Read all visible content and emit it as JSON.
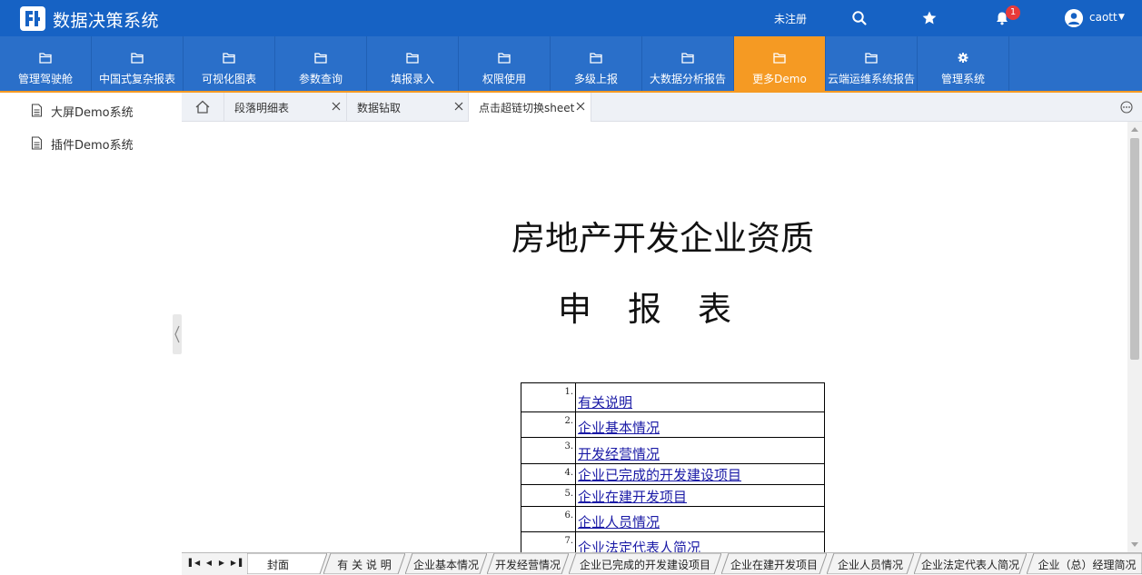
{
  "app": {
    "title": "数据决策系统",
    "brand_color": "#1662c4",
    "nav_color": "#2a6fc9",
    "accent_color": "#f59a23"
  },
  "topbar": {
    "register_label": "未注册",
    "notification_count": "1",
    "user_name": "caott",
    "icons": [
      "search-icon",
      "star-icon",
      "bell-icon",
      "user-avatar-icon",
      "caret-down-icon"
    ]
  },
  "nav": {
    "items": [
      {
        "label": "管理驾驶舱",
        "icon": "folder-icon"
      },
      {
        "label": "中国式复杂报表",
        "icon": "folder-icon"
      },
      {
        "label": "可视化图表",
        "icon": "folder-icon"
      },
      {
        "label": "参数查询",
        "icon": "folder-icon"
      },
      {
        "label": "填报录入",
        "icon": "folder-icon"
      },
      {
        "label": "权限使用",
        "icon": "folder-icon"
      },
      {
        "label": "多级上报",
        "icon": "folder-icon"
      },
      {
        "label": "大数据分析报告",
        "icon": "folder-icon"
      },
      {
        "label": "更多Demo",
        "icon": "folder-icon",
        "active": true
      },
      {
        "label": "云端运维系统报告",
        "icon": "folder-icon"
      },
      {
        "label": "管理系统",
        "icon": "gear-icon"
      }
    ]
  },
  "sidebar": {
    "items": [
      {
        "label": "大屏Demo系统",
        "icon": "document-icon"
      },
      {
        "label": "插件Demo系统",
        "icon": "document-icon"
      }
    ]
  },
  "tabs": {
    "items": [
      {
        "label": "段落明细表"
      },
      {
        "label": "数据钻取"
      },
      {
        "label": "点击超链切换sheet",
        "active": true
      }
    ]
  },
  "report": {
    "title_line1": "房地产开发企业资质",
    "title_line2": "申报表",
    "toc": [
      {
        "num": "1.",
        "label": "有关说明"
      },
      {
        "num": "2.",
        "label": "企业基本情况"
      },
      {
        "num": "3.",
        "label": "开发经营情况"
      },
      {
        "num": "4.",
        "label": "企业已完成的开发建设项目"
      },
      {
        "num": "5.",
        "label": "企业在建开发项目"
      },
      {
        "num": "6.",
        "label": "企业人员情况"
      },
      {
        "num": "7.",
        "label": "企业法定代表人简况"
      }
    ]
  },
  "sheets": {
    "nav_icons": [
      "first-sheet-icon",
      "prev-sheet-icon",
      "next-sheet-icon",
      "last-sheet-icon"
    ],
    "items": [
      {
        "label": "封面",
        "active": true
      },
      {
        "label": "有 关 说 明"
      },
      {
        "label": "企业基本情况"
      },
      {
        "label": "开发经营情况"
      },
      {
        "label": "企业已完成的开发建设项目"
      },
      {
        "label": "企业在建开发项目"
      },
      {
        "label": "企业人员情况"
      },
      {
        "label": "企业法定代表人简况"
      },
      {
        "label": "企业（总）经理简况"
      }
    ]
  }
}
